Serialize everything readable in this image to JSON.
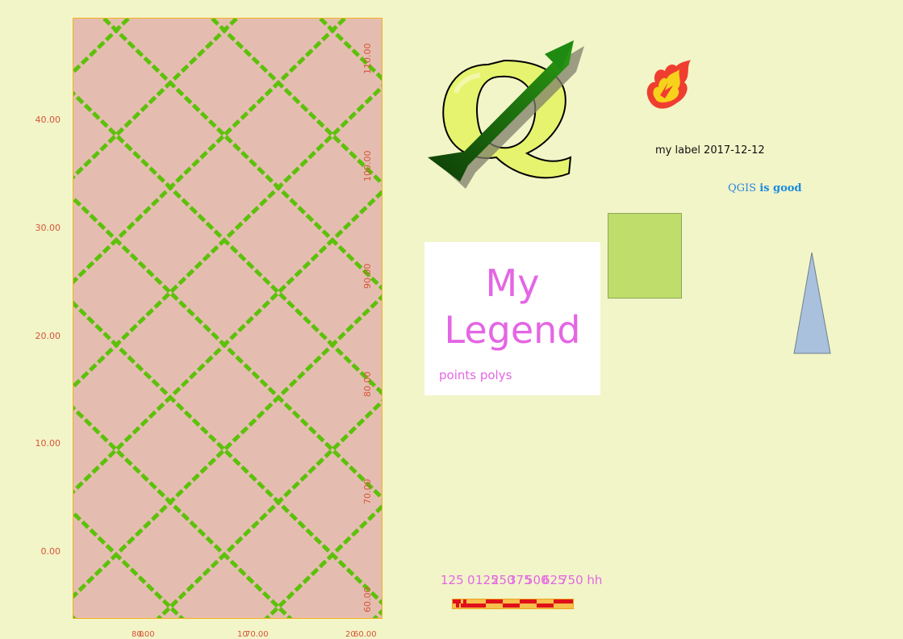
{
  "map": {
    "background_color": "#e5bdb0",
    "frame_color": "#f0b21f",
    "grid_color": "#5cc10a",
    "left_ticks": [
      "40.00",
      "30.00",
      "20.00",
      "10.00",
      "0.00"
    ],
    "right_ticks": [
      "110.00",
      "100.00",
      "90.00",
      "80.00",
      "70.00",
      "60.00"
    ],
    "bottom_ticks": [
      "0",
      "80.00",
      "10",
      "70.00",
      "20",
      "60.00"
    ]
  },
  "legend": {
    "title_line1": "My",
    "title_line2": "Legend",
    "items": "points polys",
    "color": "#e466e4"
  },
  "label": {
    "text": "my label 2017-12-12"
  },
  "html_label": {
    "plain": "QGIS ",
    "bold": "is good"
  },
  "scalebar": {
    "labels": [
      "125",
      "0",
      "125",
      "250",
      "375",
      "500",
      "625",
      "750 hh"
    ]
  },
  "icons": {
    "qgis_logo": "qgis-logo-icon",
    "north_arrow": "north-arrow-icon",
    "fire": "fire-icon",
    "triangle": "triangle-shape"
  }
}
